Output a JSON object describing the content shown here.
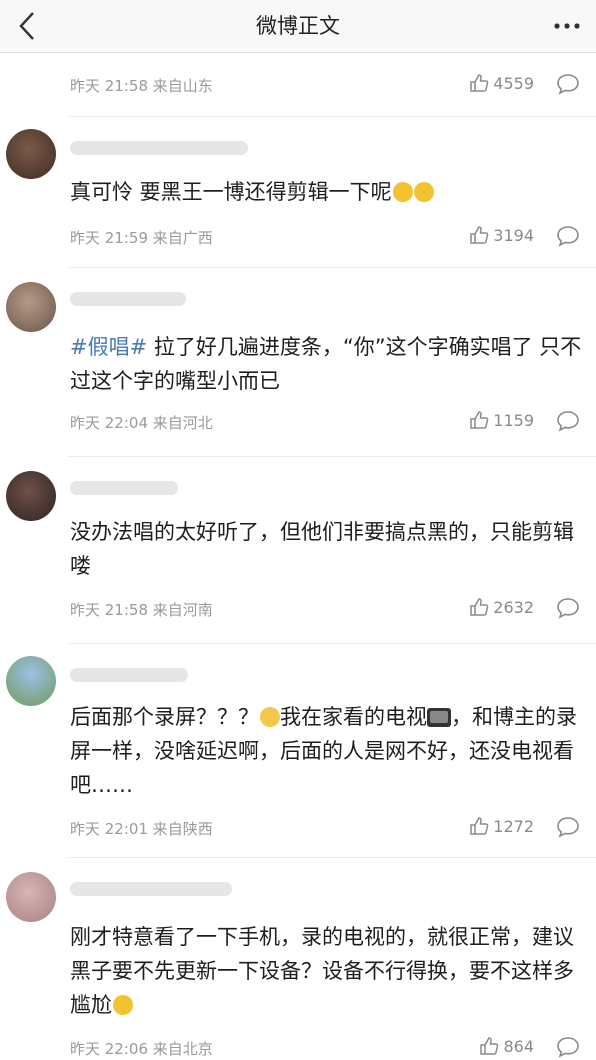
{
  "header": {
    "title": "微博正文",
    "back_icon": "chevron-left-icon",
    "more_icon": "more-dots-icon"
  },
  "comments": [
    {
      "meta": "昨天 21:58 来自山东",
      "likes": "4559"
    },
    {
      "text": "真可怜 要黑王一博还得剪辑一下呢",
      "emoji": [
        "sweat-smile-emoji",
        "sweat-smile-emoji"
      ],
      "meta": "昨天 21:59 来自广西",
      "likes": "3194"
    },
    {
      "tag": "#假唱#",
      "text": " 拉了好几遍进度条，“你”这个字确实唱了 只不过这个字的嘴型小而已",
      "meta": "昨天 22:04 来自河北",
      "likes": "1159"
    },
    {
      "text": "没办法唱的太好听了，但他们非要搞点黑的，只能剪辑喽",
      "meta": "昨天 21:58 来自河南",
      "likes": "2632"
    },
    {
      "text_a": "后面那个录屏？？？",
      "text_b": "我在家看的电视",
      "text_c": "，和博主的录屏一样，没啥延迟啊，后面的人是网不好，还没电视看吧……",
      "emoji": [
        "thinking-emoji",
        "tv-emoji"
      ],
      "meta": "昨天 22:01 来自陕西",
      "likes": "1272"
    },
    {
      "text": "刚才特意看了一下手机，录的电视的，就很正常，建议黑子要不先更新一下设备？设备不行得换，要不这样多尴尬",
      "emoji": [
        "laugh-cry-emoji"
      ],
      "meta": "昨天 22:06 来自北京",
      "likes": "864"
    }
  ],
  "colors": {
    "tag": "#4a78b4",
    "meta": "#9a9a9a",
    "topbar": "#f8f8f8"
  }
}
